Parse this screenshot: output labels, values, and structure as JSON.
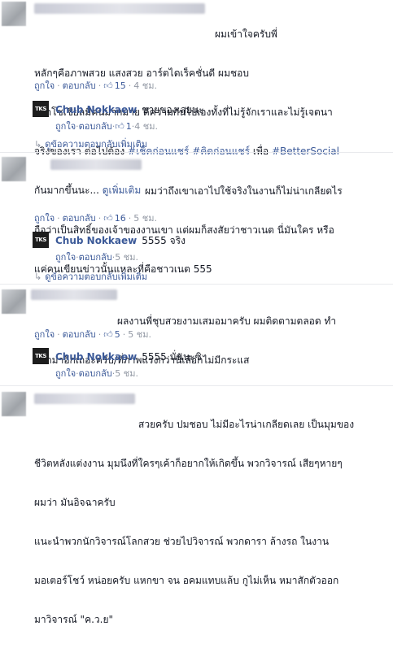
{
  "ui": {
    "like": "ถูกใจ",
    "reply": "ตอบกลับ",
    "dot": "·",
    "like_icon": "thumbs-up-icon"
  },
  "comments": [
    {
      "text_lines": [
        "ผมเข้าใจครับพี่",
        "หลักๆคือภาพสวย แสงสวย อาร์ตไดเร็คชั่นดี ผมชอบ",
        "โลกโซเชียลมีคนมากมาย ดีความกันไปเองทั้งที่ไม่รู้จักเราและไม่รู้เจตนา",
        "จริงของเรา ต่อไปต้อง",
        "กันมากขึ้นนะ..."
      ],
      "tags": [
        "#เช็คก่อนแชร์",
        "#คิดก่อนแชร์",
        "#BetterSocial"
      ],
      "tag_sep": "เพื่อ",
      "see_more": "ดูเพิ่มเติม",
      "likes": "15",
      "time": "4 ชม.",
      "reply": {
        "name": "Chub Nokkaew",
        "text": "ขายของเลยนะ",
        "likes": "1",
        "time": "4 ชม."
      },
      "more_replies": "ดูข้อความตอบกลับเพิ่มเติม"
    },
    {
      "text_lines": [
        "ผมว่าถึงเขาเอาไปใช้จริงในงานก็ไม่น่าเกลียดไร",
        "ถือว่าเป็นสิทธิ์ของเจ้าของงานเขา แต่ผมก็สงสัยว่าชาวเนต นี่มันใคร หรือ",
        "แค่คนเขียนข่าวนั้นแหละที่คือชาวเนต 555"
      ],
      "likes": "16",
      "time": "5 ชม.",
      "reply": {
        "name": "Chub Nokkaew",
        "text": "5555 จริง",
        "time": "5 ชม."
      },
      "more_replies": "ดูข้อความตอบกลับเพิ่มเติม"
    },
    {
      "text_lines": [
        "ผลงานพี่ชุบสวยงามเสมอมาครับ ผมติดตามตลอด ทำ",
        "ออกมาอีกเถอะครับ/ที่ภาพแรงกว่านี้เลือกไม่มีกระแส"
      ],
      "likes": "5",
      "time": "5 ชม.",
      "reply": {
        "name": "Chub Nokkaew",
        "text": "5555 นั่นนะซิ",
        "time": "5 ชม."
      }
    },
    {
      "text_lines": [
        "สวยครับ ปมชอบ ไม่มีอะไรน่าเกลียดเลย เป็นมุมของ",
        "ชีวิตหลังแต่งงาน มุมนึงที่ใครๆเค้าก็อยากให้เกิดขึ้น พวกวิจารณ์ เสียๆหายๆ",
        "ผมว่า มันอิจฉาครับ",
        "แนะนำพวกนักวิจารณ์โลกสวย ช่วยไปวิจารณ์ พวกดารา ล้างรถ ในงาน",
        "มอเตอร์โชว์ หน่อยครับ แหกขา จน อคมแทบแล้บ กูไม่เห็น หมาสักตัวออก",
        "มาวิจารณ์ \"ค.ว.ย\""
      ]
    }
  ]
}
